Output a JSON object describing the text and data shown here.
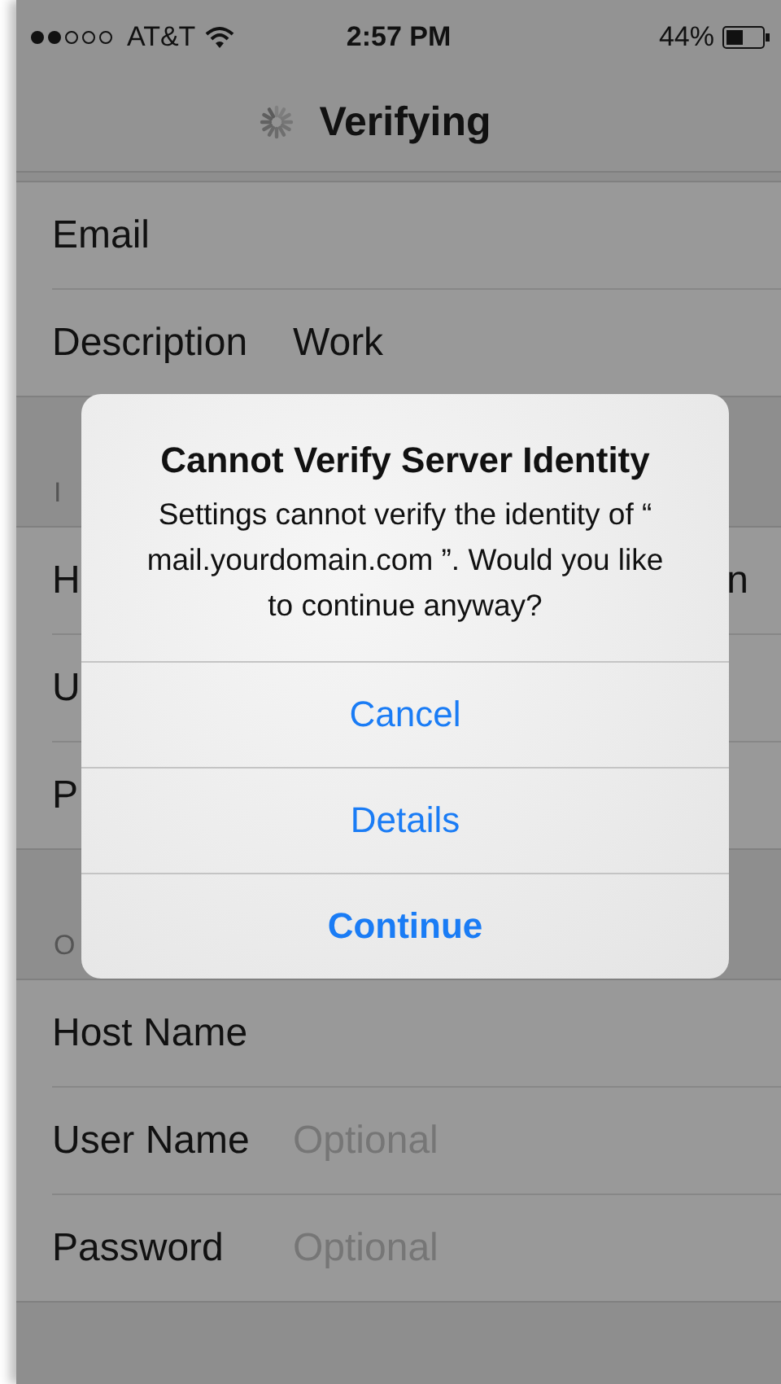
{
  "status_bar": {
    "carrier": "AT&T",
    "time": "2:57 PM",
    "battery": "44%"
  },
  "nav": {
    "title": "Verifying"
  },
  "sections": [
    {
      "rows": [
        {
          "label": "Email"
        },
        {
          "label": "Description",
          "value": "Work"
        }
      ]
    },
    {
      "header": "I",
      "rows": [
        {
          "label": "H",
          "value": "n"
        },
        {
          "label": "U"
        },
        {
          "label": "P"
        }
      ]
    },
    {
      "header": "O",
      "rows": [
        {
          "label": "Host Name"
        },
        {
          "label": "User Name",
          "placeholder": "Optional"
        },
        {
          "label": "Password",
          "placeholder": "Optional"
        }
      ]
    }
  ],
  "alert": {
    "title": "Cannot Verify Server Identity",
    "message": "Settings cannot verify the identity of “ mail.yourdomain.com ”. Would you like to continue anyway?",
    "buttons": [
      {
        "label": "Cancel",
        "kind": "normal"
      },
      {
        "label": "Details",
        "kind": "normal"
      },
      {
        "label": "Continue",
        "kind": "preferred"
      }
    ]
  }
}
